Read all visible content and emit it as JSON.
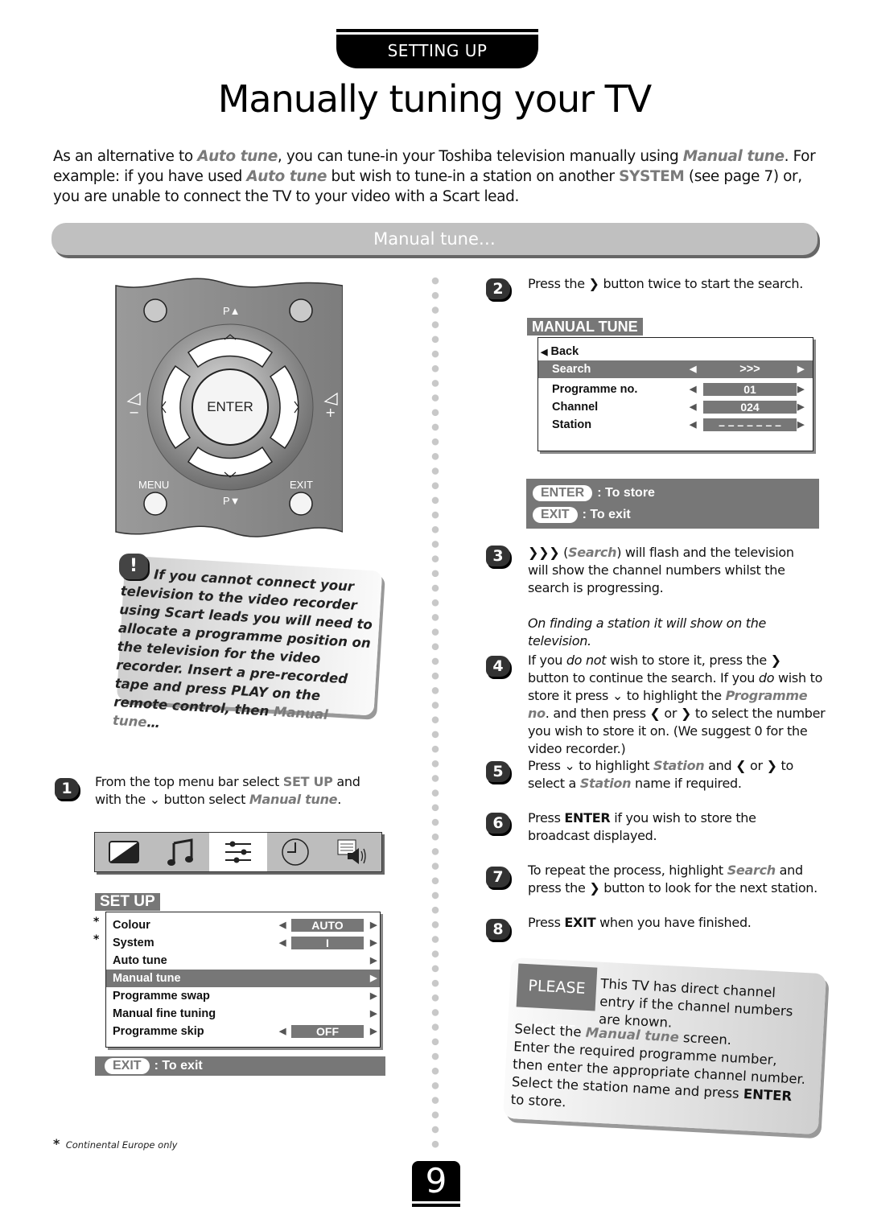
{
  "header": {
    "section_tab": "SETTING UP",
    "title": "Manually tuning your TV"
  },
  "intro": {
    "p1": "As an alternative to ",
    "auto_tune": "Auto tune",
    "p2": ", you can tune-in your Toshiba television manually using ",
    "manual_tune": "Manual tune",
    "p3": ". For example: if you have used ",
    "auto_tune_2": "Auto tune",
    "p4": " but wish to tune-in a station on another ",
    "system": "SYSTEM",
    "p5": " (see page 7) or, you are unable to connect the TV to your video with a Scart lead."
  },
  "section": {
    "title": "Manual tune…"
  },
  "remote": {
    "p_up": "P▲",
    "p_down": "P▼",
    "enter": "ENTER",
    "menu": "MENU",
    "exit": "EXIT",
    "vol_minus": "−",
    "vol_plus": "+"
  },
  "warning": {
    "badge": "!",
    "text_a": "If you cannot connect your television to the video recorder using Scart leads you will need to allocate a programme position on the television for the video recorder. Insert a pre-recorded tape and press PLAY on the remote control, then ",
    "manual_tune": "Manual tune",
    "text_b": "…"
  },
  "steps": [
    {
      "num": "1",
      "a": "From the top menu bar select ",
      "b": "SET UP",
      "c": " and with the ",
      "d": " button select ",
      "e": "Manual tune",
      "f": "."
    },
    {
      "num": "2",
      "a": "Press the ",
      "b": " button twice to start the search."
    },
    {
      "num": "3",
      "a": " (",
      "b": "Search",
      "c": ") will flash and the television will show the channel numbers whilst the search is progressing.",
      "note": "On finding a station it will show on the television."
    },
    {
      "num": "4",
      "a": "If you ",
      "b": "do not",
      "c": " wish to store it, press the ",
      "d": " button to continue the search. If you ",
      "e": "do",
      "f": " wish to store it press ",
      "g": " to highlight the ",
      "h": "Programme no",
      "i": ". and then press ",
      "j": " or ",
      "k": " to select the number you wish to store it on. (We suggest 0 for the video recorder.)"
    },
    {
      "num": "5",
      "a": "Press ",
      "b": " to highlight ",
      "c": "Station",
      "d": " and ",
      "e": " or ",
      "f": " to select a ",
      "g": "Station",
      "h": " name if required."
    },
    {
      "num": "6",
      "a": "Press ",
      "b": "ENTER",
      "c": " if you wish to store the broadcast displayed."
    },
    {
      "num": "7",
      "a": "To repeat the process, highlight ",
      "b": "Search",
      "c": " and press the ",
      "d": " button to look for the next station."
    },
    {
      "num": "8",
      "a": "Press ",
      "b": "EXIT",
      "c": " when you have finished."
    }
  ],
  "menubar": {
    "icons": [
      "picture-icon",
      "sound-icon",
      "setup-icon",
      "clock-icon",
      "teletext-icon"
    ],
    "active": "setup-icon"
  },
  "setup_menu": {
    "title": "SET UP",
    "rows": [
      {
        "label": "Colour",
        "value": "AUTO",
        "star": "*"
      },
      {
        "label": "System",
        "value": "I",
        "star": "*"
      },
      {
        "label": "Auto tune",
        "value": ""
      },
      {
        "label": "Manual tune",
        "value": "",
        "selected": true
      },
      {
        "label": "Programme swap",
        "value": ""
      },
      {
        "label": "Manual fine tuning",
        "value": ""
      },
      {
        "label": "Programme skip",
        "value": "OFF"
      }
    ],
    "exit_key": "EXIT",
    "exit_label": ": To exit"
  },
  "manual_tune_menu": {
    "title": "MANUAL TUNE",
    "back": "Back",
    "rows": [
      {
        "label": "Search",
        "value": ">>>",
        "selected": true
      },
      {
        "label": "Programme no.",
        "value": "01"
      },
      {
        "label": "Channel",
        "value": "024"
      },
      {
        "label": "Station",
        "value": "– – – – – – –"
      }
    ],
    "keys": [
      {
        "key": "ENTER",
        "label": ": To store"
      },
      {
        "key": "EXIT",
        "label": ": To exit"
      }
    ]
  },
  "please_note": {
    "badge": "PLEASE NOTE",
    "line1": "This TV has direct channel entry if the channel numbers are known.",
    "l2a": "Select the ",
    "l2b": "Manual tune",
    "l2c": " screen.",
    "l3": "Enter the required programme number, then enter the appropriate channel number.",
    "l4a": "Select the station name and press ",
    "l4b": "ENTER",
    "l4c": " to store."
  },
  "footnote": {
    "star": "*",
    "text": "Continental Europe only"
  },
  "page_number": "9"
}
